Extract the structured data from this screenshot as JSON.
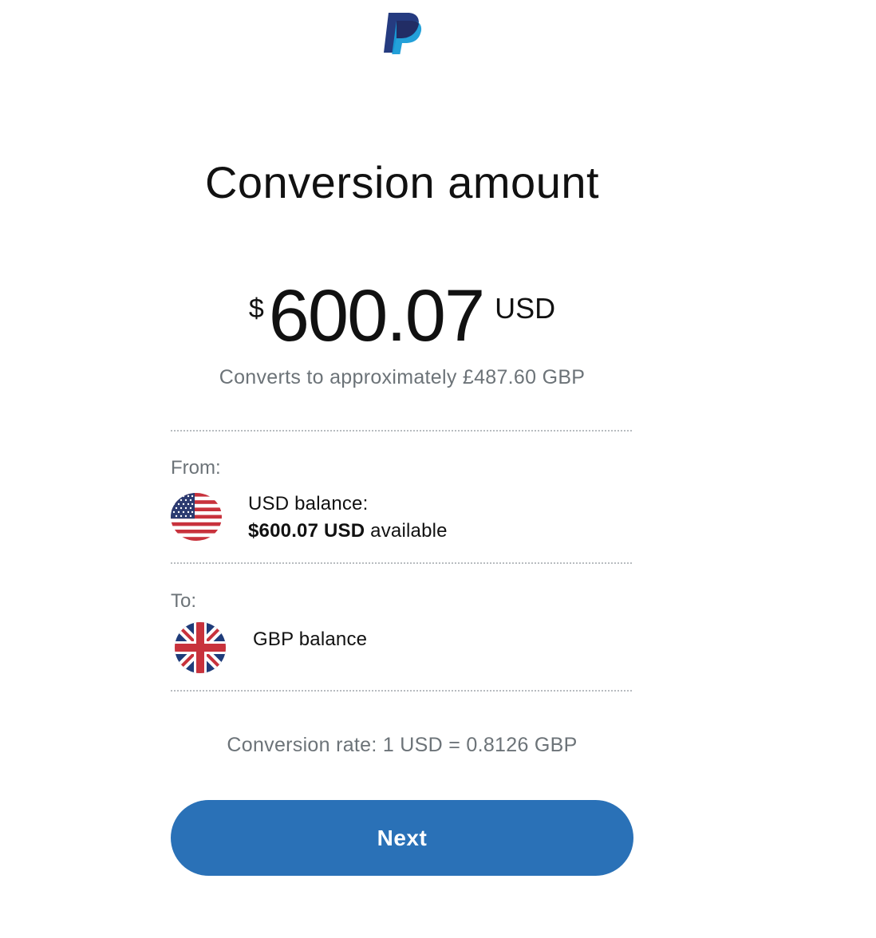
{
  "brand": {
    "logo_icon": "paypal-logo",
    "colors": {
      "dark": "#253b80",
      "light": "#179bd7"
    }
  },
  "page": {
    "title": "Conversion amount"
  },
  "amount": {
    "symbol": "$",
    "value": "600.07",
    "currency": "USD",
    "converts_text": "Converts to approximately £487.60 GBP"
  },
  "from": {
    "label": "From:",
    "flag_icon": "us-flag-icon",
    "balance_title": "USD balance:",
    "available_amount": "$600.07 USD",
    "available_suffix": " available"
  },
  "to": {
    "label": "To:",
    "flag_icon": "uk-flag-icon",
    "balance_title": "GBP balance"
  },
  "rate": {
    "text": "Conversion rate: 1 USD = 0.8126 GBP"
  },
  "actions": {
    "next_label": "Next",
    "button_color": "#2a71b7"
  },
  "colors": {
    "secondary_text": "#6c7378",
    "divider": "#b8bcc0"
  }
}
